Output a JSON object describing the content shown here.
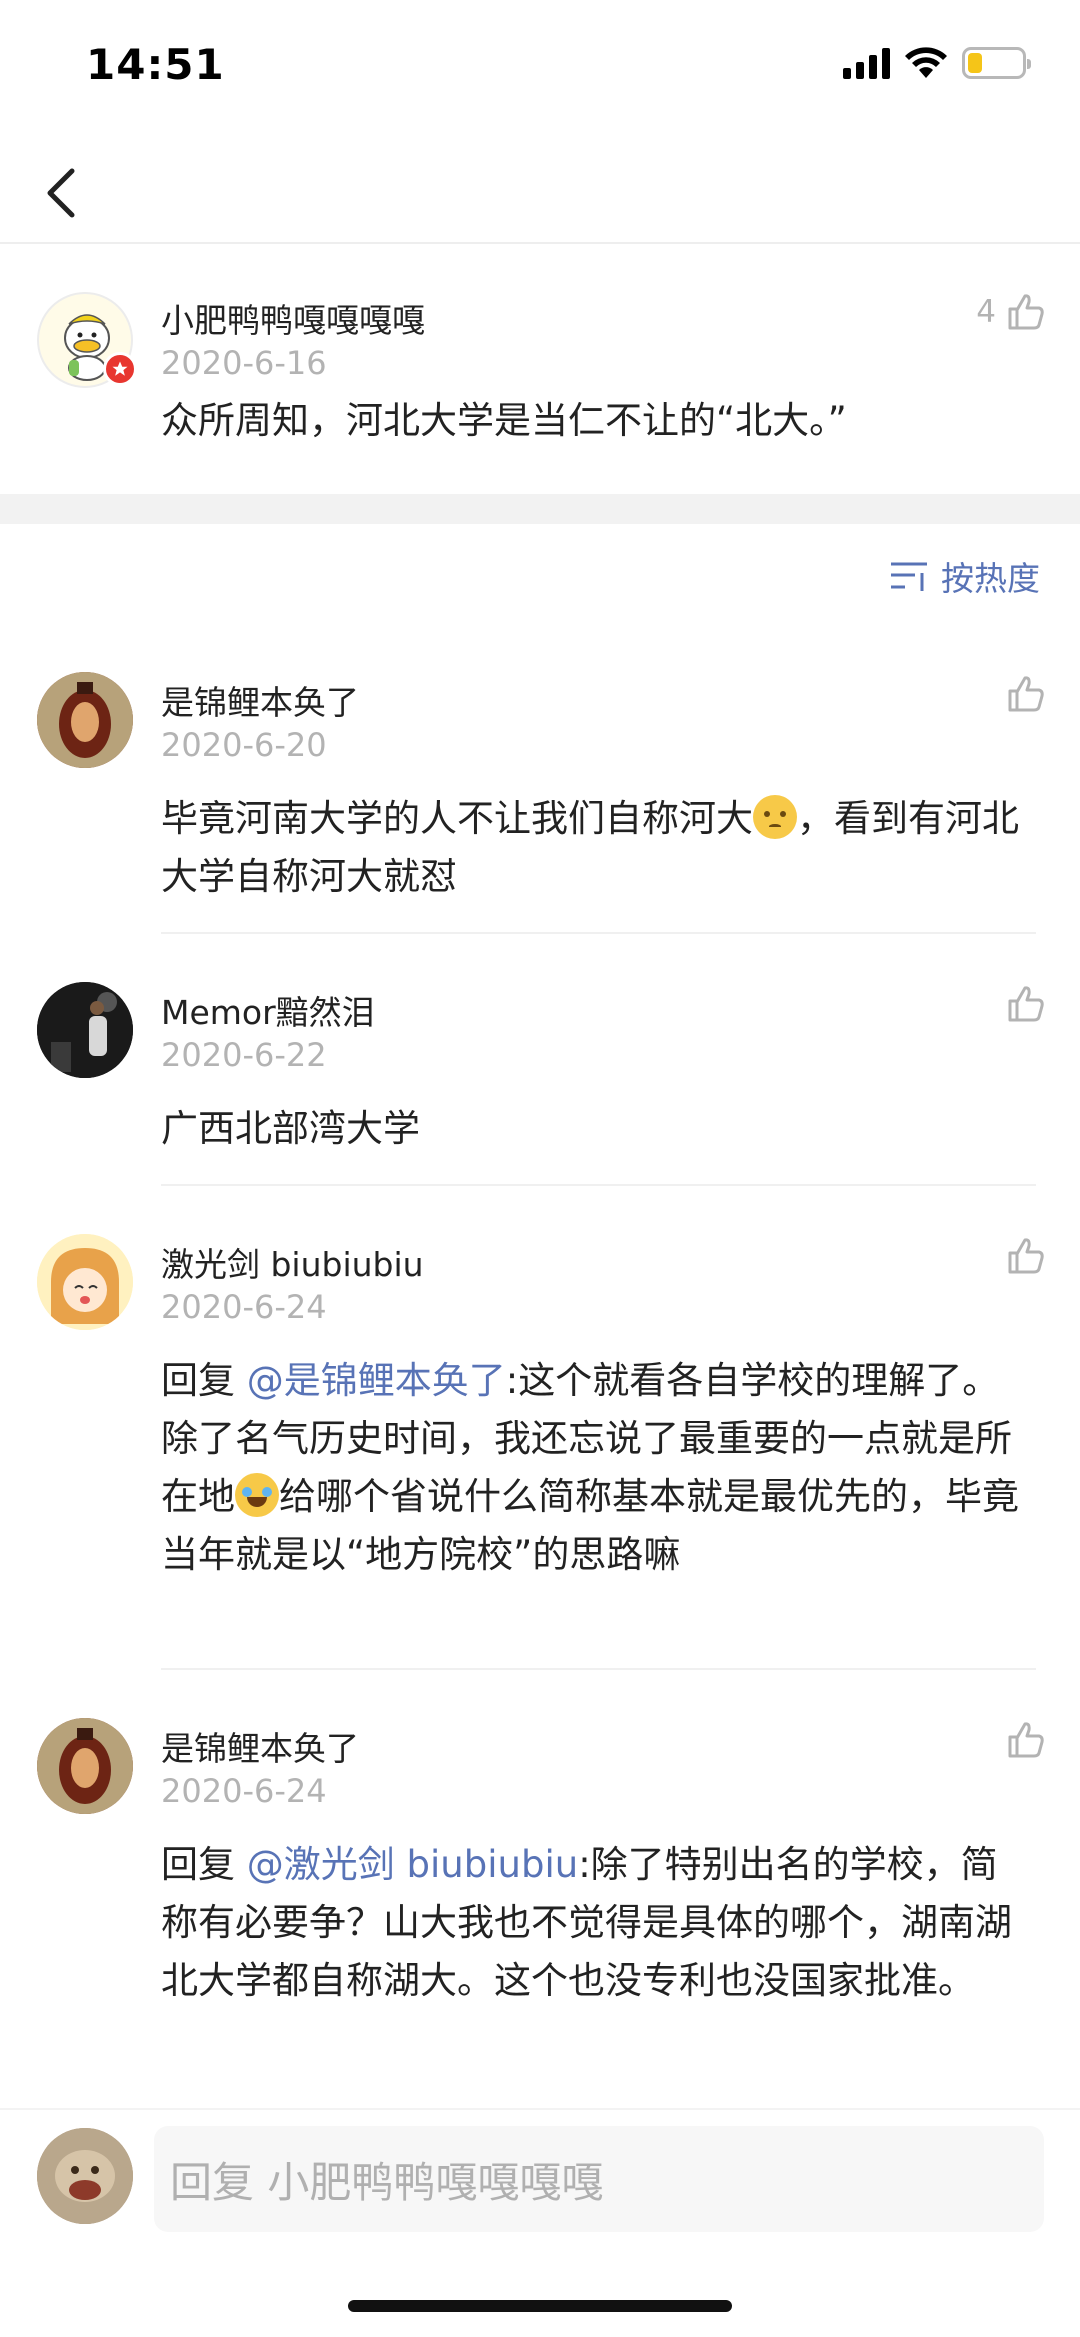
{
  "status_bar": {
    "time": "14:51"
  },
  "nav": {
    "back_icon": "chevron-left-icon"
  },
  "post": {
    "author": "小肥鸭鸭嘎嘎嘎嘎",
    "date": "2020-6-16",
    "like_count": "4",
    "content": "众所周知，河北大学是当仁不让的“北大。”",
    "badge_icon": "star-badge-icon"
  },
  "sort": {
    "label": "按热度",
    "icon": "sort-icon"
  },
  "comments": [
    {
      "author": "是锦鲤本奂了",
      "date": "2020-6-20",
      "content_a": "毕竟河南大学的人不让我们自称河大",
      "content_b": "，看到有河北大学自称河大就怼"
    },
    {
      "author": "Memor黯然泪",
      "date": "2020-6-22",
      "content": "广西北部湾大学"
    },
    {
      "author": "激光剑 biubiubiu",
      "date": "2020-6-24",
      "reply_prefix": "回复 ",
      "mention": "@是锦鲤本奂了",
      "content_a": ":这个就看各自学校的理解了。除了名气历史时间，我还忘说了最重要的一点就是所在地",
      "content_b": "给哪个省说什么简称基本就是最优先的，毕竟当年就是以“地方院校”的思路嘛"
    },
    {
      "author": "是锦鲤本奂了",
      "date": "2020-6-24",
      "reply_prefix": "回复 ",
      "mention": "@激光剑 biubiubiu",
      "content": ":除了特别出名的学校，简称有必要争？山大我也不觉得是具体的哪个，湖南湖北大学都自称湖大。这个也没专利也没国家批准。"
    }
  ],
  "reply_bar": {
    "placeholder": "回复 小肥鸭鸭嘎嘎嘎嘎"
  },
  "colors": {
    "link": "#5873b6",
    "muted": "#b3b3b3",
    "separator": "#f2f2f2"
  }
}
